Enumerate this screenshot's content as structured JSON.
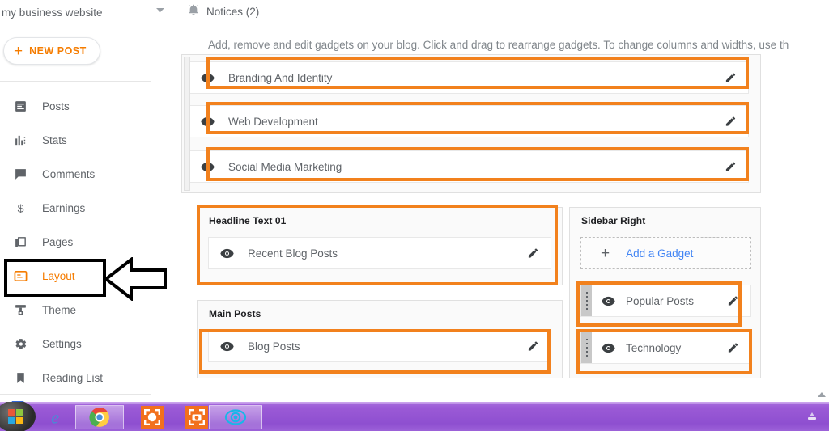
{
  "sidebar": {
    "blog_title": "my business website",
    "blog_select_icon": "chevron-down-icon",
    "new_post": {
      "label": "NEW POST",
      "plus": "+"
    },
    "items": [
      {
        "label": "Posts",
        "icon": "posts-icon"
      },
      {
        "label": "Stats",
        "icon": "stats-icon"
      },
      {
        "label": "Comments",
        "icon": "comments-icon"
      },
      {
        "label": "Earnings",
        "icon": "earnings-dollar-icon"
      },
      {
        "label": "Pages",
        "icon": "pages-icon"
      },
      {
        "label": "Layout",
        "icon": "layout-icon"
      },
      {
        "label": "Theme",
        "icon": "theme-icon"
      },
      {
        "label": "Settings",
        "icon": "gear-icon"
      },
      {
        "label": "Reading List",
        "icon": "bookmark-icon"
      }
    ],
    "active_item": "Layout"
  },
  "main": {
    "notices": {
      "label": "Notices (2)",
      "icon": "bell-icon"
    },
    "description": "Add, remove and edit gadgets on your blog. Click and drag to rearrange gadgets. To change columns and widths, use th",
    "top_section": {
      "gadgets": [
        {
          "label": "Branding And Identity",
          "eye_icon": "eye-icon",
          "edit_icon": "pencil-icon"
        },
        {
          "label": "Web Development",
          "eye_icon": "eye-icon",
          "edit_icon": "pencil-icon"
        },
        {
          "label": "Social Media Marketing",
          "eye_icon": "eye-icon",
          "edit_icon": "pencil-icon"
        }
      ]
    },
    "headline_panel": {
      "title": "Headline Text 01",
      "gadgets": [
        {
          "label": "Recent Blog Posts",
          "eye_icon": "eye-icon",
          "edit_icon": "pencil-icon"
        }
      ]
    },
    "main_posts_panel": {
      "title": "Main Posts",
      "gadgets": [
        {
          "label": "Blog Posts",
          "eye_icon": "eye-icon",
          "edit_icon": "pencil-icon"
        }
      ]
    },
    "sidebar_right_panel": {
      "title": "Sidebar Right",
      "add_gadget": {
        "label": "Add a Gadget",
        "plus": "+",
        "icon": "plus-icon"
      },
      "gadgets": [
        {
          "label": "Popular Posts",
          "eye_icon": "eye-icon",
          "edit_icon": "pencil-icon",
          "handle_icon": "drag-handle-icon"
        },
        {
          "label": "Technology",
          "eye_icon": "eye-icon",
          "edit_icon": "pencil-icon",
          "handle_icon": "drag-handle-icon"
        }
      ]
    }
  },
  "annotations": {
    "highlight_color": "#f2811d",
    "callout_color": "#000000",
    "arrow_icon": "left-arrow-callout-icon",
    "layout_box_icon": "layout-highlight-box"
  },
  "taskbar": {
    "start_icon": "windows-start-icon",
    "buttons": [
      {
        "icon": "internet-explorer-icon"
      },
      {
        "icon": "google-chrome-icon"
      },
      {
        "icon": "screenshot-tool-icon"
      },
      {
        "icon": "screenshot-camera-icon"
      },
      {
        "icon": "blue-eye-icon"
      }
    ],
    "tray_icon": "tray-icon"
  },
  "colors": {
    "accent_orange": "#f57c00",
    "annotation_orange": "#f2811d",
    "link_blue": "#4285f4",
    "text_gray": "#5f6368",
    "taskbar_purple": "#9b5ad6"
  }
}
